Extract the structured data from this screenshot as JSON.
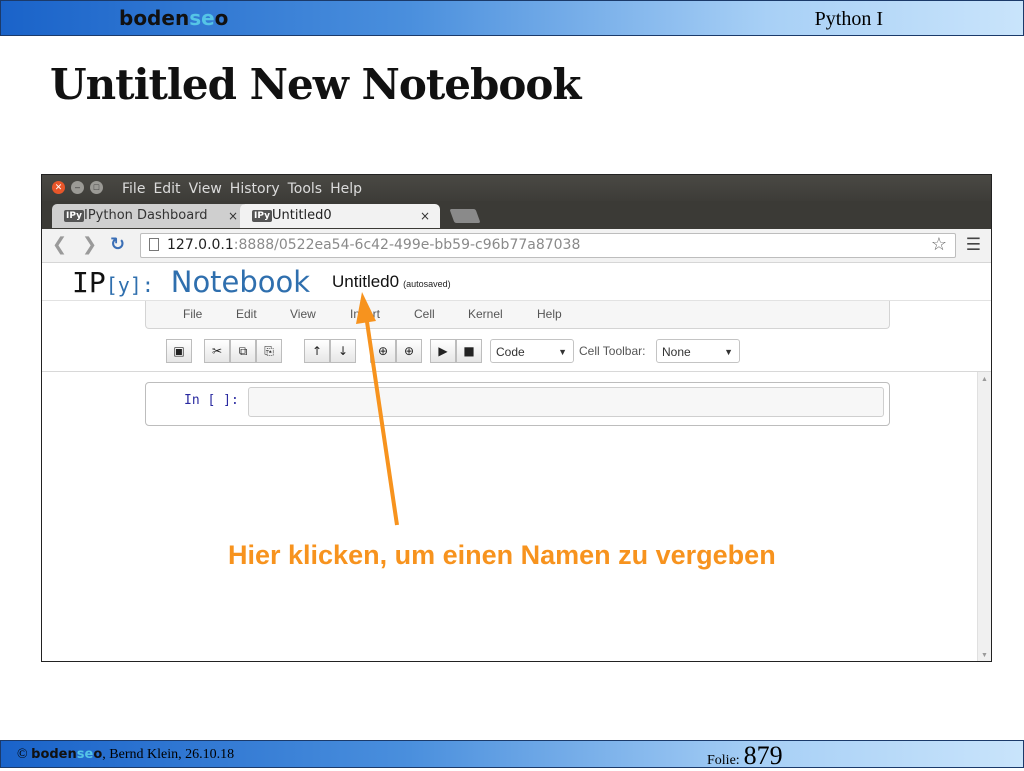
{
  "slide": {
    "header_logo": {
      "part1": "boden",
      "part2": "se",
      "part3": "o"
    },
    "header_right": "Python I",
    "title": "Untitled New Notebook",
    "footer": {
      "copyright": "©",
      "logo": {
        "part1": "boden",
        "part2": "se",
        "part3": "o"
      },
      "credit": ", Bernd Klein, 26.10.18",
      "folie_label": "Folie:",
      "folie_number": "879"
    }
  },
  "browser": {
    "menu": [
      "File",
      "Edit",
      "View",
      "History",
      "Tools",
      "Help"
    ],
    "tabs": [
      {
        "favicon": "IPy",
        "label": "IPython Dashboard",
        "close": "×"
      },
      {
        "favicon": "IPy",
        "label": "Untitled0",
        "close": "×"
      }
    ],
    "url_host": "127.0.0.1",
    "url_path": ":8888/0522ea54-6c42-499e-bb59-c96b77a87038"
  },
  "notebook": {
    "logo_ip": "IP",
    "logo_y": "[y]:",
    "logo_word": "Notebook",
    "name": "Untitled0",
    "save_status": "(autosaved)",
    "menu": [
      "File",
      "Edit",
      "View",
      "Insert",
      "Cell",
      "Kernel",
      "Help"
    ],
    "cell_type": "Code",
    "cell_toolbar_label": "Cell Toolbar:",
    "cell_toolbar_value": "None",
    "prompt": "In [ ]:"
  },
  "annotation": {
    "text": "Hier klicken, um einen Namen zu vergeben",
    "color": "#f7931e"
  },
  "colors": {
    "accent": "#2f6fae",
    "header_gradient_start": "#1a63c9"
  }
}
